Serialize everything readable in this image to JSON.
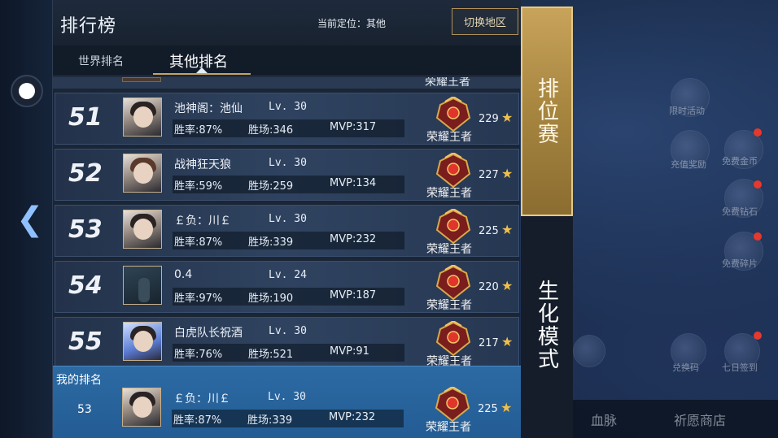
{
  "header": {
    "title": "排行榜",
    "location": "当前定位：其他",
    "switch_button": "切换地区"
  },
  "tabs": {
    "world": "世界排名",
    "other": "其他排名"
  },
  "peek_row": {
    "tier": "荣耀王者"
  },
  "rows": [
    {
      "rank": "51",
      "name": "池神阁：池仙",
      "level": "Lv. 30",
      "winrate": "胜率:87%",
      "wins": "胜场:346",
      "mvp": "MVP:317",
      "tier": "荣耀王者",
      "stars": "229"
    },
    {
      "rank": "52",
      "name": "战神狂天狼",
      "level": "Lv. 30",
      "winrate": "胜率:59%",
      "wins": "胜场:259",
      "mvp": "MVP:134",
      "tier": "荣耀王者",
      "stars": "227"
    },
    {
      "rank": "53",
      "name": "￡负：川￡",
      "level": "Lv. 30",
      "winrate": "胜率:87%",
      "wins": "胜场:339",
      "mvp": "MVP:232",
      "tier": "荣耀王者",
      "stars": "225"
    },
    {
      "rank": "54",
      "name": "0.4",
      "level": "Lv. 24",
      "winrate": "胜率:97%",
      "wins": "胜场:190",
      "mvp": "MVP:187",
      "tier": "荣耀王者",
      "stars": "220"
    },
    {
      "rank": "55",
      "name": "白虎队长祝酒",
      "level": "Lv. 30",
      "winrate": "胜率:76%",
      "wins": "胜场:521",
      "mvp": "MVP:91",
      "tier": "荣耀王者",
      "stars": "217"
    }
  ],
  "my_rank": {
    "label": "我的排名",
    "rank": "53",
    "name": "￡负：川￡",
    "level": "Lv. 30",
    "winrate": "胜率:87%",
    "wins": "胜场:339",
    "mvp": "MVP:232",
    "tier": "荣耀王者",
    "stars": "225"
  },
  "modes": {
    "ranked": "排位赛",
    "bio": "生化模式"
  },
  "background": {
    "limited_event": "限时活动",
    "recharge_reward": "充值奖励",
    "free_gold": "免费金币",
    "free_diamond": "免费钻石",
    "free_shards": "免费碎片",
    "redeem_code": "兑换码",
    "seven_day": "七日签到",
    "bloodline": "血脉",
    "wish_shop": "祈愿商店"
  },
  "colors": {
    "gold_accent": "#c6a465",
    "my_rank_bg": "#2c6aa3",
    "star": "#f0c04a"
  },
  "icons": {
    "star": "★",
    "back_arrow": "❮"
  }
}
